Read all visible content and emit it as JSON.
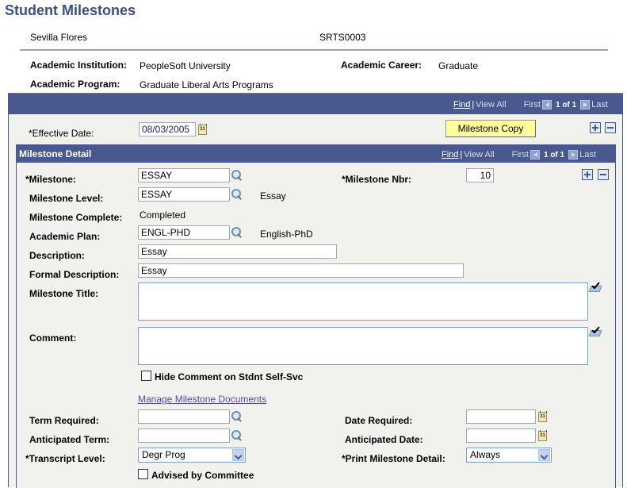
{
  "page": {
    "title": "Student Milestones"
  },
  "student": {
    "name": "Sevilla Flores",
    "id": "SRTS0003"
  },
  "academic": {
    "institution_label": "Academic Institution:",
    "institution_value": "PeopleSoft University",
    "career_label": "Academic Career:",
    "career_value": "Graduate",
    "program_label": "Academic Program:",
    "program_value": "Graduate Liberal Arts Programs"
  },
  "outer_nav": {
    "find": "Find",
    "separator": "|",
    "view_all": "View All",
    "first": "First",
    "count": "1 of 1",
    "last": "Last"
  },
  "effective_date": {
    "label": "*Effective Date:",
    "value": "08/03/2005"
  },
  "milestone_copy_button": "Milestone Copy",
  "detail": {
    "title": "Milestone Detail",
    "nav": {
      "find": "Find",
      "separator": "|",
      "view_all": "View All",
      "first": "First",
      "count": "1 of 1",
      "last": "Last"
    },
    "milestone": {
      "label": "*Milestone:",
      "value": "ESSAY"
    },
    "milestone_nbr": {
      "label": "*Milestone Nbr:",
      "value": "10"
    },
    "milestone_level": {
      "label": "Milestone Level:",
      "value": "ESSAY",
      "description": "Essay"
    },
    "milestone_complete": {
      "label": "Milestone Complete:",
      "value": "Completed"
    },
    "academic_plan": {
      "label": "Academic Plan:",
      "value": "ENGL-PHD",
      "description": "English-PhD"
    },
    "description": {
      "label": "Description:",
      "value": "Essay"
    },
    "formal_description": {
      "label": "Formal Description:",
      "value": "Essay"
    },
    "milestone_title": {
      "label": "Milestone Title:",
      "value": ""
    },
    "comment": {
      "label": "Comment:",
      "value": ""
    },
    "hide_comment": {
      "label": "Hide Comment on Stdnt Self-Svc",
      "checked": false
    },
    "manage_documents_link": "Manage Milestone Documents",
    "term_required": {
      "label": "Term Required:",
      "value": ""
    },
    "date_required": {
      "label": "Date Required:",
      "value": ""
    },
    "anticipated_term": {
      "label": "Anticipated Term:",
      "value": ""
    },
    "anticipated_date": {
      "label": "Anticipated Date:",
      "value": ""
    },
    "transcript_level": {
      "label": "*Transcript Level:",
      "value": "Degr Prog"
    },
    "print_milestone_detail": {
      "label": "*Print Milestone Detail:",
      "value": "Always"
    },
    "advised_by_committee": {
      "label": "Advised by Committee",
      "checked": false
    }
  },
  "icons": {
    "calendar": "31",
    "lookup": "magnifier-icon",
    "spellcheck": "spellcheck-icon",
    "add_row": "plus-icon",
    "delete_row": "minus-icon"
  }
}
